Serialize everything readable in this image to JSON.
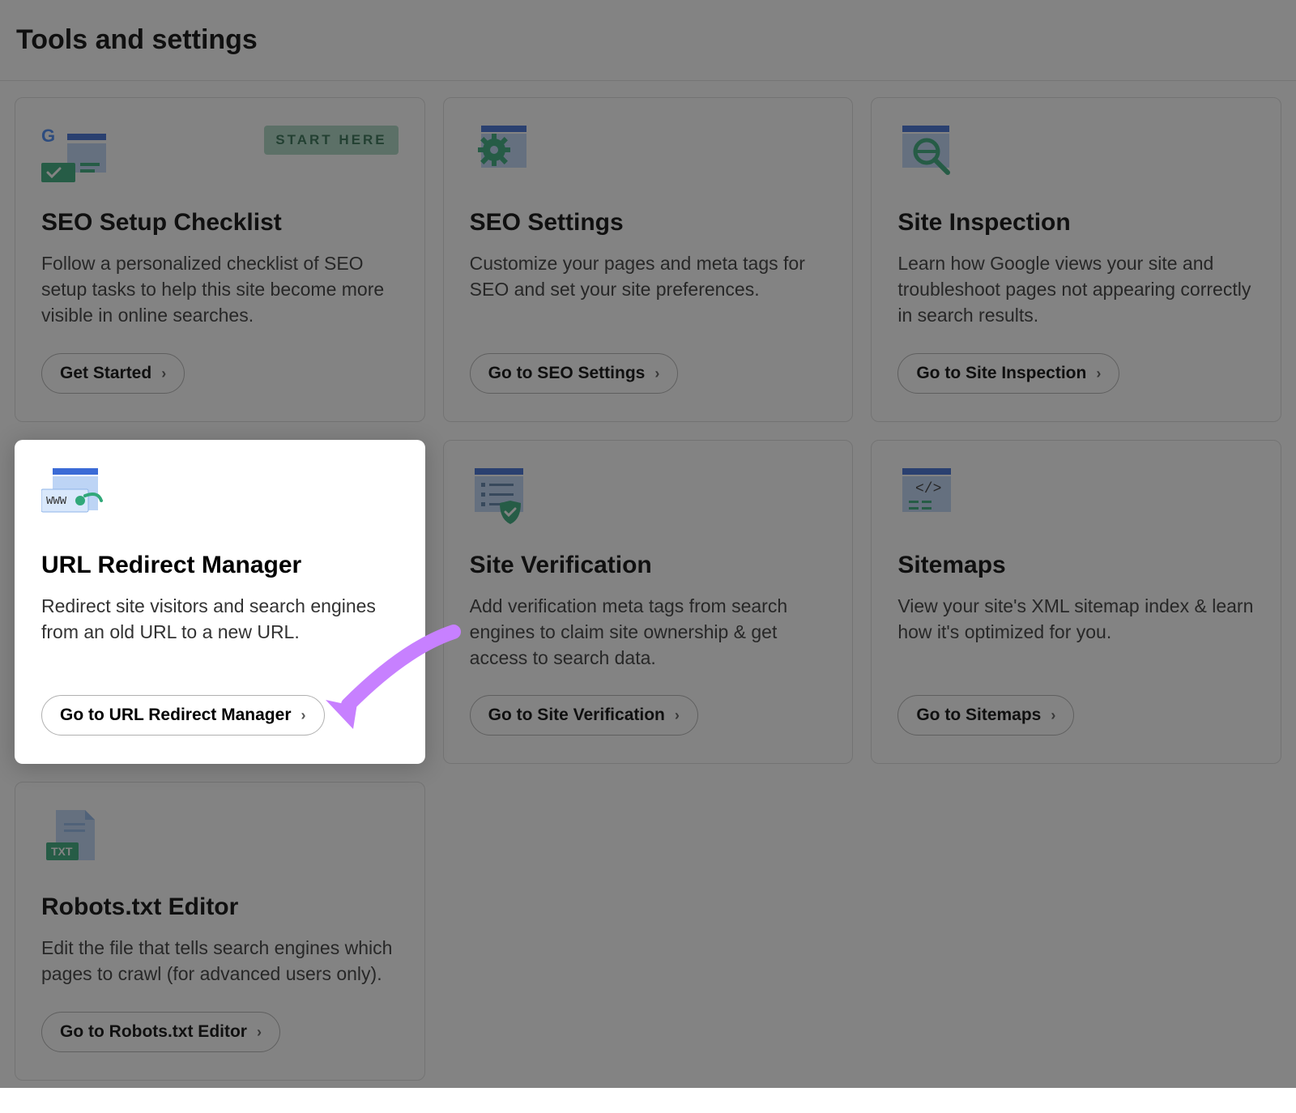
{
  "header": {
    "title": "Tools and settings"
  },
  "cards": [
    {
      "badge": "START HERE",
      "title": "SEO Setup Checklist",
      "desc": "Follow a personalized checklist of SEO setup tasks to help this site become more visible in online searches.",
      "button": "Get Started"
    },
    {
      "title": "SEO Settings",
      "desc": "Customize your pages and meta tags for SEO and set your site preferences.",
      "button": "Go to SEO Settings"
    },
    {
      "title": "Site Inspection",
      "desc": "Learn how Google views your site and troubleshoot pages not appearing correctly in search results.",
      "button": "Go to Site Inspection"
    },
    {
      "title": "URL Redirect Manager",
      "desc": "Redirect site visitors and search engines from an old URL to a new URL.",
      "button": "Go to URL Redirect Manager"
    },
    {
      "title": "Site Verification",
      "desc": "Add verification meta tags from search engines to claim site ownership & get access to search data.",
      "button": "Go to Site Verification"
    },
    {
      "title": "Sitemaps",
      "desc": "View your site's XML sitemap index & learn how it's optimized for you.",
      "button": "Go to Sitemaps"
    },
    {
      "title": "Robots.txt Editor",
      "desc": "Edit the file that tells search engines which pages to crawl (for advanced users only).",
      "button": "Go to Robots.txt Editor"
    }
  ]
}
